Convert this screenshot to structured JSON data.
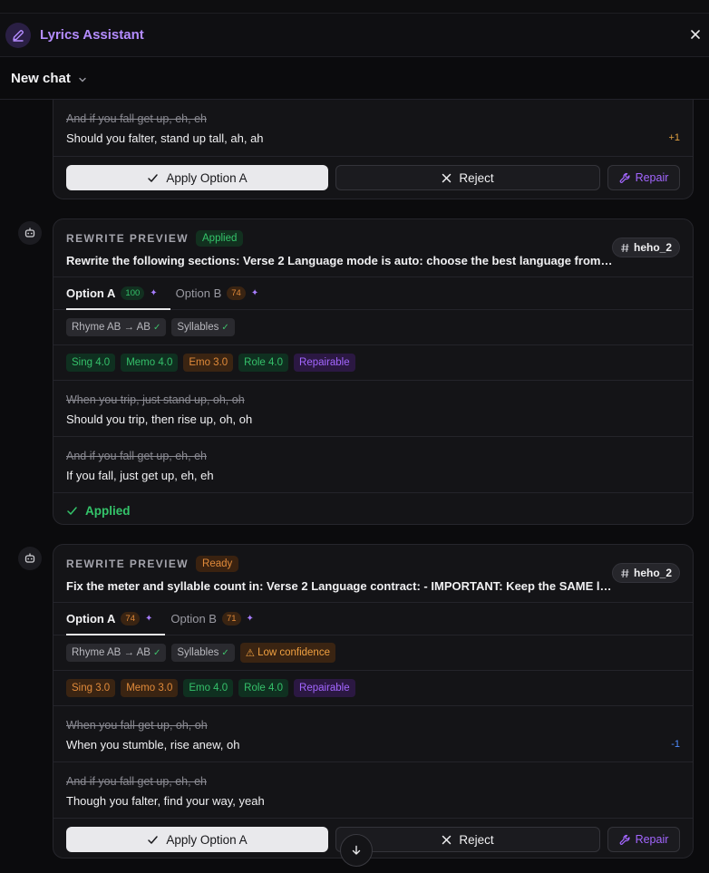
{
  "app": {
    "title": "Lyrics Assistant"
  },
  "chat": {
    "title": "New chat"
  },
  "card0": {
    "lines": [
      {
        "old": "And if you fall get up, eh, eh",
        "new": "Should you falter, stand up tall, ah, ah",
        "delta": "+1"
      }
    ],
    "apply_label": "Apply Option A",
    "reject_label": "Reject",
    "repair_label": "Repair"
  },
  "card1": {
    "kicker": "REWRITE PREVIEW",
    "status": "Applied",
    "prompt": "Rewrite the following sections: Verse 2 Language mode is auto: choose the best language from the context",
    "tag": "heho_2",
    "tabs": [
      {
        "label": "Option A",
        "score": "100"
      },
      {
        "label": "Option B",
        "score": "74"
      }
    ],
    "checks": [
      {
        "label": "Rhyme AB → AB"
      },
      {
        "label": "Syllables"
      }
    ],
    "metrics": [
      {
        "label": "Sing 4.0"
      },
      {
        "label": "Memo 4.0"
      },
      {
        "label": "Emo 3.0"
      },
      {
        "label": "Role 4.0"
      },
      {
        "label": "Repairable"
      }
    ],
    "lines": [
      {
        "old": "When you trip, just stand up, oh, oh",
        "new": "Should you trip, then rise up, oh, oh"
      },
      {
        "old": "And if you fall get up, eh, eh",
        "new": "If you fall, just get up, eh, eh"
      }
    ],
    "footer": "Applied"
  },
  "card2": {
    "kicker": "REWRITE PREVIEW",
    "status": "Ready",
    "prompt": "Fix the meter and syllable count in: Verse 2 Language contract: - IMPORTANT: Keep the SAME language",
    "tag": "heho_2",
    "tabs": [
      {
        "label": "Option A",
        "score": "74"
      },
      {
        "label": "Option B",
        "score": "71"
      }
    ],
    "checks": [
      {
        "label": "Rhyme AB → AB"
      },
      {
        "label": "Syllables"
      },
      {
        "label": "Low confidence"
      }
    ],
    "metrics": [
      {
        "label": "Sing 3.0"
      },
      {
        "label": "Memo 3.0"
      },
      {
        "label": "Emo 4.0"
      },
      {
        "label": "Role 4.0"
      },
      {
        "label": "Repairable"
      }
    ],
    "lines": [
      {
        "old": "When you fall get up, oh, oh",
        "new": "When you stumble, rise anew, oh",
        "delta": "-1"
      },
      {
        "old": "And if you fall get up, eh, eh",
        "new": "Though you falter, find your way, yeah"
      }
    ],
    "apply_label": "Apply Option A",
    "reject_label": "Reject",
    "repair_label": "Repair"
  },
  "icons": {
    "logo": "pen-icon",
    "close": "close-icon",
    "chevron": "chevron-down-icon",
    "avatar": "bot-icon",
    "tag": "hash-icon",
    "apply": "check-icon",
    "reject": "x-icon",
    "repair": "wrench-icon",
    "scroll": "arrow-down-icon"
  },
  "colors": {
    "accent": "#b48cff",
    "success": "#34c46a",
    "warning": "#e08a3a",
    "link": "#4f8cff"
  }
}
